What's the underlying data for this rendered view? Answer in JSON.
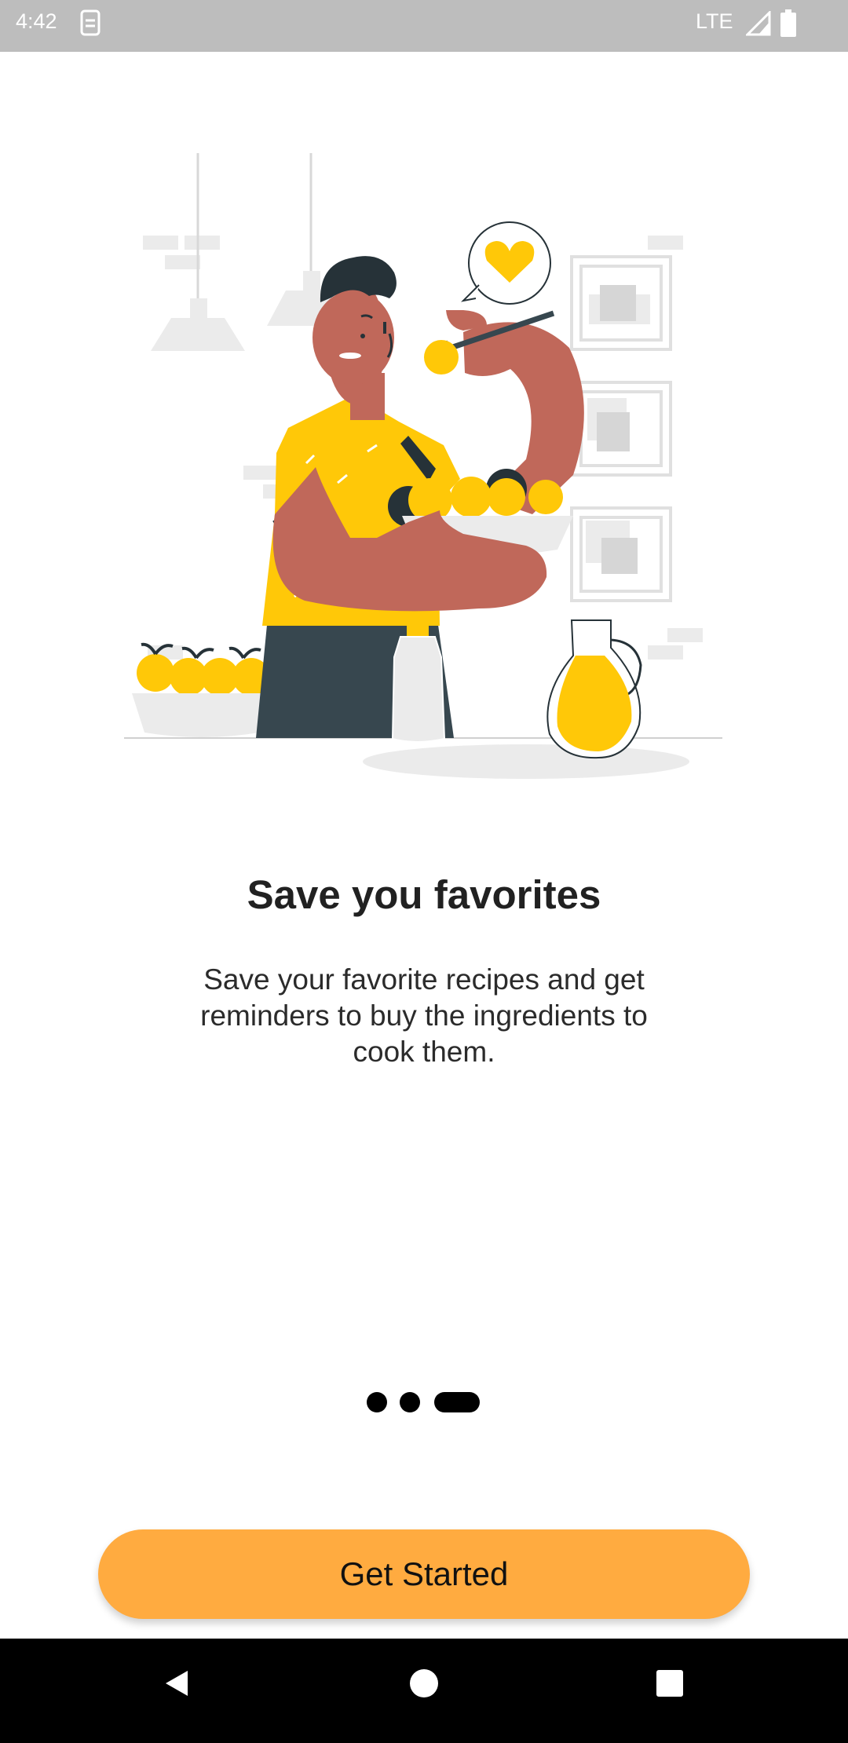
{
  "status_bar": {
    "time": "4:42",
    "network": "LTE",
    "icons": [
      "sim-card-icon",
      "signal-icon",
      "battery-icon"
    ]
  },
  "onboarding": {
    "title": "Save you favorites",
    "description": "Save your favorite recipes and get reminders to buy the ingredients to cook them.",
    "page_indicator": {
      "count": 3,
      "active_index": 2
    },
    "cta_label": "Get Started"
  },
  "navigation": {
    "icons": [
      "back-icon",
      "home-icon",
      "recents-icon"
    ]
  },
  "colors": {
    "accent": "#ffab40",
    "illustration_yellow": "#ffc808",
    "skin": "#c0685a",
    "hair_pants": "#263238"
  }
}
